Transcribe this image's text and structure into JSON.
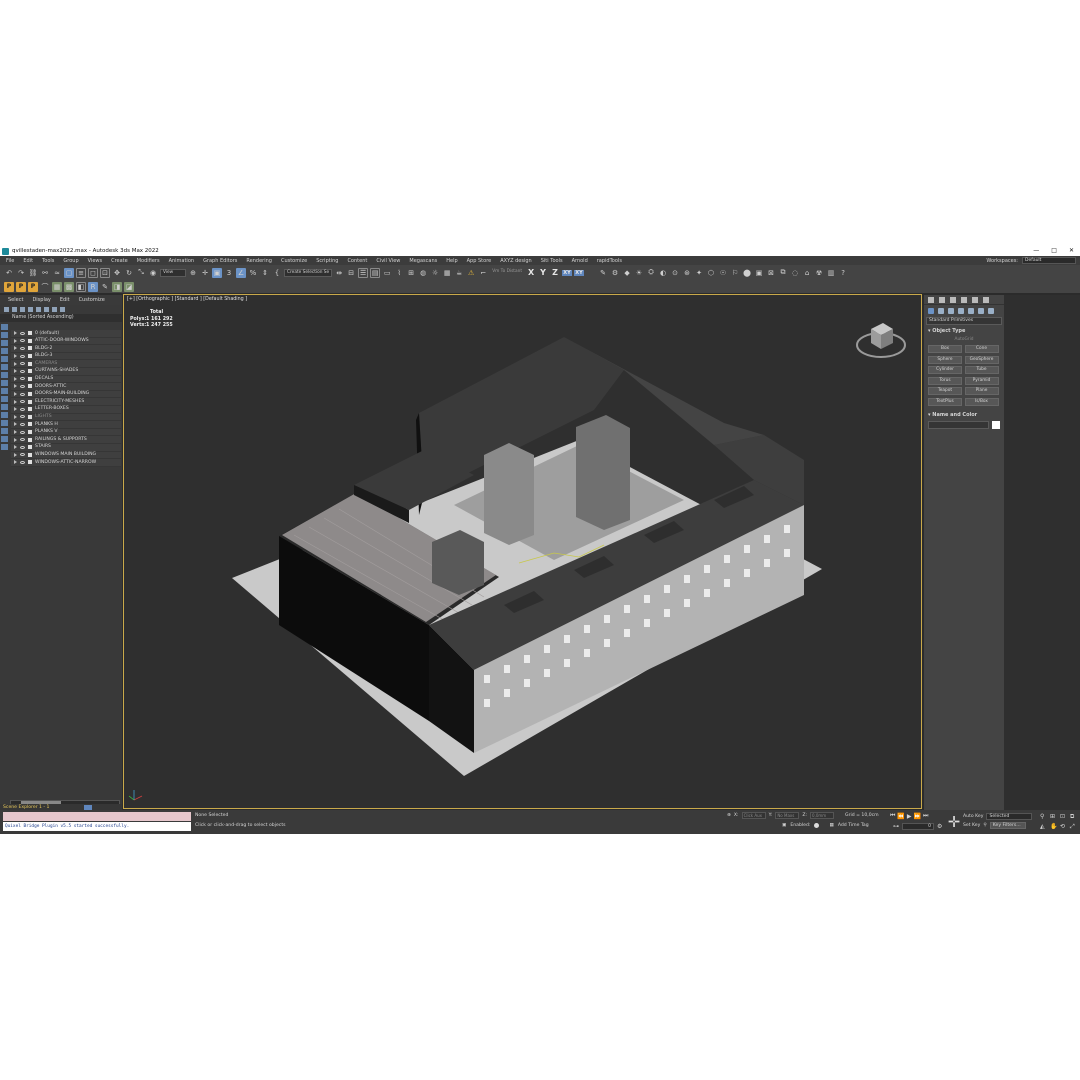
{
  "title": "qvillestaden-max2022.max - Autodesk 3ds Max 2022",
  "window_controls": [
    "—",
    "□",
    "✕"
  ],
  "menu": [
    "File",
    "Edit",
    "Tools",
    "Group",
    "Views",
    "Create",
    "Modifiers",
    "Animation",
    "Graph Editors",
    "Rendering",
    "Customize",
    "Scripting",
    "Content",
    "Civil View",
    "Megascans",
    "Help",
    "App Store",
    "AXYZ design",
    "Siti Tools",
    "Arnold",
    "rapidTools"
  ],
  "workspaces": {
    "label": "Workspaces:",
    "value": "Default"
  },
  "toolbar": {
    "filter_value": "View",
    "selection_set": "Create Selection Se",
    "snap_label": "Vm To Distant",
    "axes": [
      "X",
      "Y",
      "Z",
      "XY",
      "XY"
    ]
  },
  "explorer": {
    "menu": [
      "Select",
      "Display",
      "Edit",
      "Customize"
    ],
    "header": "Name (Sorted Ascending)",
    "layers": [
      {
        "name": "0 (default)",
        "dim": false
      },
      {
        "name": "ATTIC-DOOR-WINDOWS",
        "dim": false
      },
      {
        "name": "BLDG-2",
        "dim": false
      },
      {
        "name": "BLDG-3",
        "dim": false
      },
      {
        "name": "CAMERAS",
        "dim": true
      },
      {
        "name": "CURTAINS-SHADES",
        "dim": false
      },
      {
        "name": "DECALS",
        "dim": false
      },
      {
        "name": "DOORS-ATTIC",
        "dim": false
      },
      {
        "name": "DOORS-MAIN-BUILDING",
        "dim": false
      },
      {
        "name": "ELECTRICITY-MESHES",
        "dim": false
      },
      {
        "name": "LETTER-BOXES",
        "dim": false
      },
      {
        "name": "LIGHTS",
        "dim": true
      },
      {
        "name": "PLANKS H",
        "dim": false
      },
      {
        "name": "PLANKS V",
        "dim": false
      },
      {
        "name": "RAILINGS & SUPPORTS",
        "dim": false
      },
      {
        "name": "STAIRS",
        "dim": false
      },
      {
        "name": "WINDOWS MAIN BUILDING",
        "dim": false
      },
      {
        "name": "WINDOWS-ATTIC-NARROW",
        "dim": false
      }
    ],
    "footer": "Scene Explorer 1 - 1"
  },
  "viewport": {
    "label": "[+] [Orthographic ] [Standard ] [Default Shading ]",
    "stats": {
      "total": "Total",
      "polys_label": "Polys:",
      "polys": "1 161 292",
      "verts_label": "Verts:",
      "verts": "1 247 255"
    }
  },
  "command_panel": {
    "dropdown": "Standard Primitives",
    "object_type": "Object Type",
    "autogrid": "AutoGrid",
    "primitives": [
      "Box",
      "Cone",
      "Sphere",
      "GeoSphere",
      "Cylinder",
      "Tube",
      "Torus",
      "Pyramid",
      "Teapot",
      "Plane",
      "TextPlus",
      "Is/Box"
    ],
    "name_and_color": "Name and Color"
  },
  "status": {
    "maxscript_output": "Quixel Bridge Plugin v5.5 started successfully.",
    "selection": "None Selected",
    "prompt": "Click or click-and-drag to select objects",
    "x_label": "X:",
    "x_value": "Click Aux",
    "y_label": "Y:",
    "y_value": "No Maxs",
    "z_label": "Z:",
    "z_value": "0,0mm",
    "grid": "Grid = 10,0cm",
    "enabled": "Enabled:",
    "add_time_tag": "Add Time Tag",
    "frame": "0",
    "auto_key": "Auto Key",
    "set_key": "Set Key",
    "key_mode": "Selected",
    "key_filters": "Key Filters..."
  }
}
